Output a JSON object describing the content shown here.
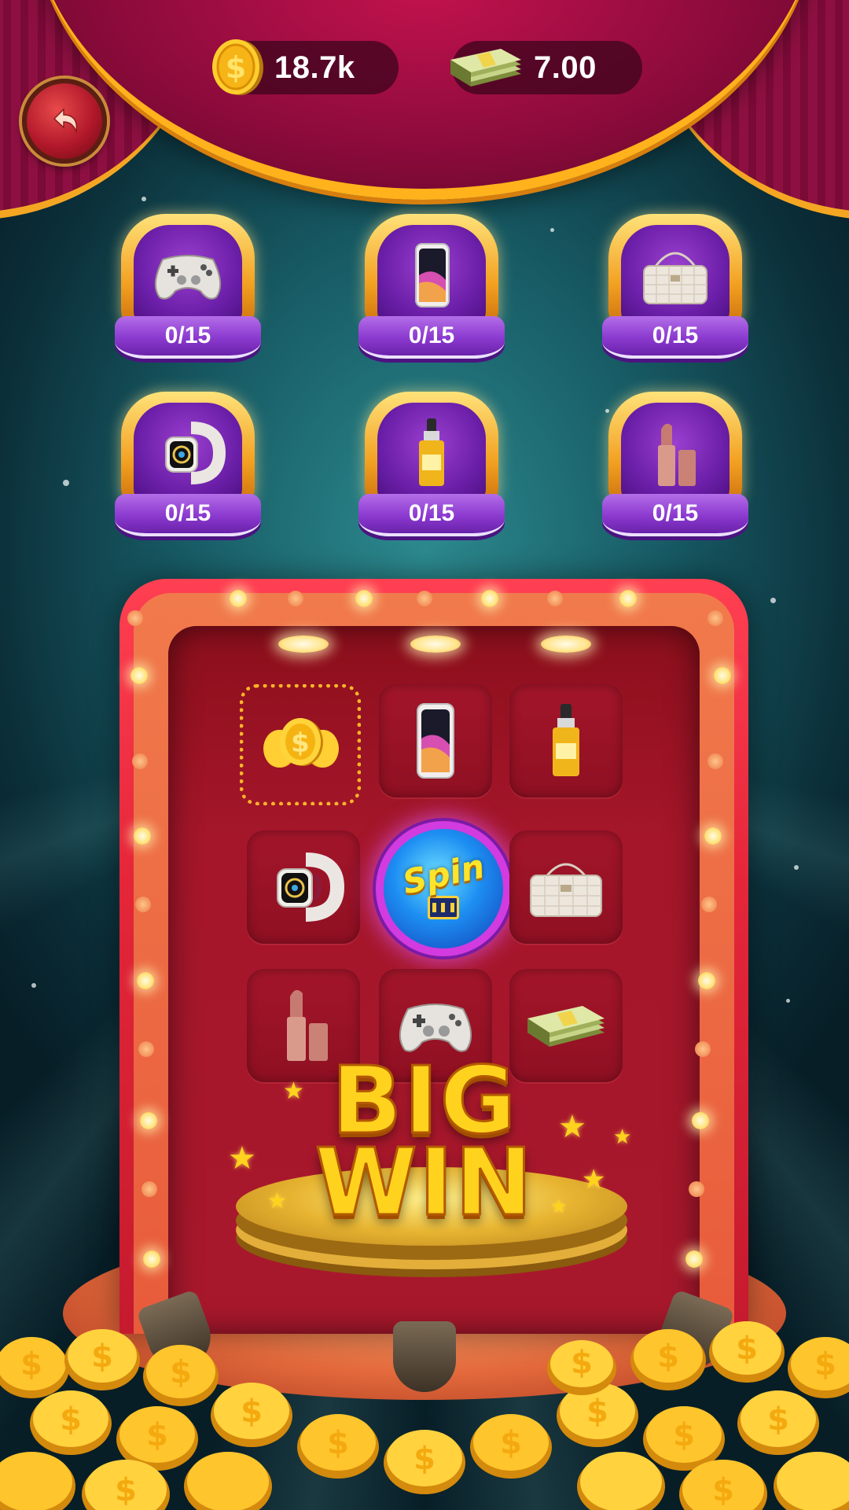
{
  "header": {
    "coins_value": "18.7k",
    "cash_value": "7.00",
    "icons": {
      "back": "back-arrow-icon",
      "coins": "gold-coin-icon",
      "cash": "cash-stack-icon"
    }
  },
  "prizes": [
    {
      "item": "game-controller",
      "progress": "0/15"
    },
    {
      "item": "smartphone",
      "progress": "0/15"
    },
    {
      "item": "handbag",
      "progress": "0/15"
    },
    {
      "item": "smartwatch",
      "progress": "0/15"
    },
    {
      "item": "perfume-serum",
      "progress": "0/15"
    },
    {
      "item": "lipstick",
      "progress": "0/15"
    }
  ],
  "slot_grid": [
    {
      "item": "coins",
      "selected": true
    },
    {
      "item": "smartphone",
      "selected": false
    },
    {
      "item": "perfume-serum",
      "selected": false
    },
    {
      "item": "smartwatch",
      "selected": false
    },
    {
      "item": "spin-button",
      "selected": false
    },
    {
      "item": "handbag",
      "selected": false
    },
    {
      "item": "lipstick",
      "selected": false
    },
    {
      "item": "game-controller",
      "selected": false
    },
    {
      "item": "cash-stack",
      "selected": false
    }
  ],
  "spin_label": "Spin",
  "banner": {
    "line1": "BIG",
    "line2": "WIN"
  },
  "colors": {
    "background": "#175a64",
    "curtain": "#8d0b3c",
    "gold": "#ffb21c",
    "machine": "#e52639",
    "badge": "#6b1fa8"
  }
}
